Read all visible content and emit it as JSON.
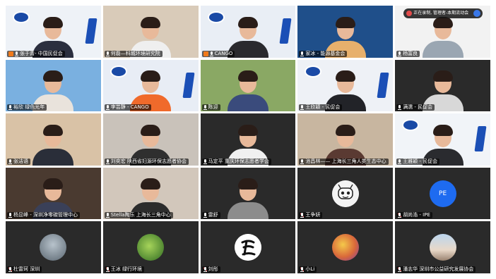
{
  "notice_text": "正在录制, 管理者-本期流动会",
  "participants": [
    {
      "name": "张于青- 中国民促会",
      "type": "video",
      "bg": "#eef2f7",
      "shirt": "#2b2f3f",
      "role": "host"
    },
    {
      "name": "何磊—科城环境研究院",
      "type": "video",
      "bg": "#d9cbb9",
      "shirt": "#efefef"
    },
    {
      "name": "CANGO",
      "type": "video",
      "bg": "#e9eef5",
      "shirt": "#2a2a2e",
      "role": "host"
    },
    {
      "name": "家冰 - 能源基金会",
      "type": "video",
      "bg": "#1f4f8a",
      "shirt": "#e7b06c"
    },
    {
      "name": "杨富良",
      "type": "video",
      "bg": "#f2f2f2",
      "shirt": "#9aa6b2"
    },
    {
      "name": "裕欣 绿色光年",
      "type": "video",
      "bg": "#7ab0e0",
      "shirt": "#e9e3dc"
    },
    {
      "name": "李芸静 - CANGO",
      "type": "video",
      "bg": "#e8edf5",
      "shirt": "#f06a2b"
    },
    {
      "name": "陈迎",
      "type": "video",
      "bg": "#8aa864",
      "shirt": "#3a4b7c"
    },
    {
      "name": "王欣颖 - 民促会",
      "type": "video",
      "bg": "#eef1f6",
      "shirt": "#222328"
    },
    {
      "name": "满濡 - 民促会",
      "type": "video",
      "bg": "#2a2a2a",
      "shirt": "#d8d8d8"
    },
    {
      "name": "张洁语",
      "type": "video",
      "bg": "#d9c2a6",
      "shirt": "#2a2e39"
    },
    {
      "name": "刘奕宏 陕西省妇源环保志愿者协会",
      "type": "video",
      "bg": "#c9c2ba",
      "shirt": "#2f2f2f"
    },
    {
      "name": "马定平 重庆环保志愿者学会",
      "type": "video",
      "bg": "#2a2a2a",
      "shirt": "#f0f0f0"
    },
    {
      "name": "池昌林—— 上海长三角人类生态中心",
      "type": "video",
      "bg": "#c8b6a0",
      "shirt": "#5a3a32"
    },
    {
      "name": "王雅颖 - 民促会",
      "type": "video",
      "bg": "#f1f4f8",
      "shirt": "#2a2b2f"
    },
    {
      "name": "杨显峰 - 深圳净零碳管理中心",
      "type": "video",
      "bg": "#4a3a30",
      "shirt": "#3a4058"
    },
    {
      "name": "Stella陶乐 上海长三角中心",
      "type": "video",
      "bg": "#d2c7bb",
      "shirt": "#2c2c2c"
    },
    {
      "name": "雷舒",
      "type": "video",
      "bg": "#2a2a2a",
      "shirt": "#8c8c8c"
    },
    {
      "name": "王争妍",
      "type": "avatar",
      "avatar": "robot",
      "bg": "#2a2a2a"
    },
    {
      "name": "胡尚浩 - IPE",
      "type": "avatar",
      "avatar": "PE",
      "bg": "#2a2a2a"
    },
    {
      "name": "杜雷珂 深圳",
      "type": "avatar",
      "avatar": "round-gray",
      "bg": "#2a2a2a"
    },
    {
      "name": "王冰 绿行环境",
      "type": "avatar",
      "avatar": "round-green",
      "bg": "#2a2a2a"
    },
    {
      "name": "刘彤",
      "type": "avatar",
      "avatar": "calligraphy",
      "bg": "#2a2a2a"
    },
    {
      "name": "小Li",
      "type": "avatar",
      "avatar": "round-colorful",
      "bg": "#2a2a2a"
    },
    {
      "name": "潘志华 深圳市公益研究发展协会",
      "type": "avatar",
      "avatar": "round-photo",
      "bg": "#2a2a2a"
    }
  ],
  "colors": {
    "tile_dark": "#2b2b2b",
    "label_bg": "#000000",
    "host_badge": "#f07a1b",
    "pe_blue": "#1e6bf0"
  }
}
